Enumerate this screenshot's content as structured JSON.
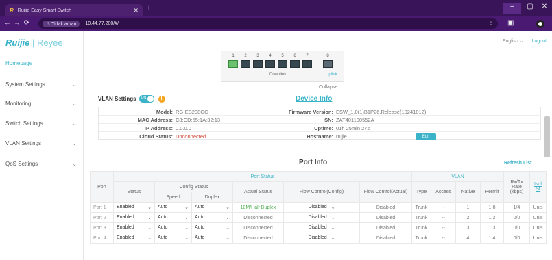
{
  "browser": {
    "tab_title": "Ruijie Easy Smart Switch",
    "tab_favicon": "R",
    "url_warning": "Tidak aman",
    "url": "10.44.77.200/#/"
  },
  "sidebar": {
    "logo_main": "Ruijie",
    "logo_sub": " | Reyee",
    "items": [
      {
        "label": "Homepage"
      },
      {
        "label": "System Settings"
      },
      {
        "label": "Monitoring"
      },
      {
        "label": "Switch Settings"
      },
      {
        "label": "VLAN Settings"
      },
      {
        "label": "QoS Settings"
      }
    ]
  },
  "header": {
    "language": "English",
    "logout": "Logout"
  },
  "switch_panel": {
    "ports": [
      "1",
      "2",
      "3",
      "4",
      "5",
      "6",
      "7",
      "8"
    ],
    "downlink_label": "Downlink",
    "uplink_label": "Uplink"
  },
  "collapse_label": "Collapse",
  "vlan_settings": {
    "label": "VLAN Settings",
    "toggle_text": "ON"
  },
  "device_info": {
    "title": "Device Info",
    "model_k": "Model:",
    "model_v": "RG-ES208GC",
    "mac_k": "MAC Address:",
    "mac_v": "C8:CD:55:1A:32:13",
    "ip_k": "IP Address:",
    "ip_v": "0.0.0.0",
    "cloud_k": "Cloud Status:",
    "cloud_v": "Unconnected",
    "fw_k": "Firmware Version:",
    "fw_v": "ESW_1.0(1)B1P26,Release(10241012)",
    "sn_k": "SN:",
    "sn_v": "ZAT401100552A",
    "uptime_k": "Uptime:",
    "uptime_v": "01h 25min 27s",
    "host_k": "Hostname:",
    "host_v": "ruijie",
    "edit": "Edit"
  },
  "port_info": {
    "title": "Port Info",
    "refresh": "Refresh List",
    "headers": {
      "port": "Port",
      "port_status": "Port Status",
      "vlan": "VLAN",
      "status": "Status",
      "config_status": "Config Status",
      "speed": "Speed",
      "duplex": "Duplex",
      "actual_status": "Actual Status",
      "flow_config": "Flow Control(Config)",
      "flow_actual": "Flow Control(Actual)",
      "type": "Type",
      "access": "Access",
      "native": "Native",
      "permit": "Permit",
      "rate": "Rx/Tx Rate (kbps)",
      "isolation": "Isol St"
    },
    "rows": [
      {
        "port": "Port 1",
        "status": "Enabled",
        "speed": "Auto",
        "duplex": "Auto",
        "actual": "10M/Half Duplex",
        "flow_cfg": "Disabled",
        "flow_act": "Disabled",
        "type": "Trunk",
        "access": "--",
        "native": "1",
        "permit": "1-8",
        "rate": "1/4",
        "iso": "Unis"
      },
      {
        "port": "Port 2",
        "status": "Enabled",
        "speed": "Auto",
        "duplex": "Auto",
        "actual": "Disconnected",
        "flow_cfg": "Disabled",
        "flow_act": "Disabled",
        "type": "Trunk",
        "access": "--",
        "native": "2",
        "permit": "1,2",
        "rate": "0/0",
        "iso": "Unis"
      },
      {
        "port": "Port 3",
        "status": "Enabled",
        "speed": "Auto",
        "duplex": "Auto",
        "actual": "Disconnected",
        "flow_cfg": "Disabled",
        "flow_act": "Disabled",
        "type": "Trunk",
        "access": "--",
        "native": "3",
        "permit": "1,3",
        "rate": "0/0",
        "iso": "Unis"
      },
      {
        "port": "Port 4",
        "status": "Enabled",
        "speed": "Auto",
        "duplex": "Auto",
        "actual": "Disconnected",
        "flow_cfg": "Disabled",
        "flow_act": "Disabled",
        "type": "Trunk",
        "access": "--",
        "native": "4",
        "permit": "1,4",
        "rate": "0/0",
        "iso": "Unis"
      }
    ]
  },
  "colors": {
    "accent": "#3ab3c8",
    "port_up": "#6ac26e",
    "chrome": "#3a1458"
  }
}
